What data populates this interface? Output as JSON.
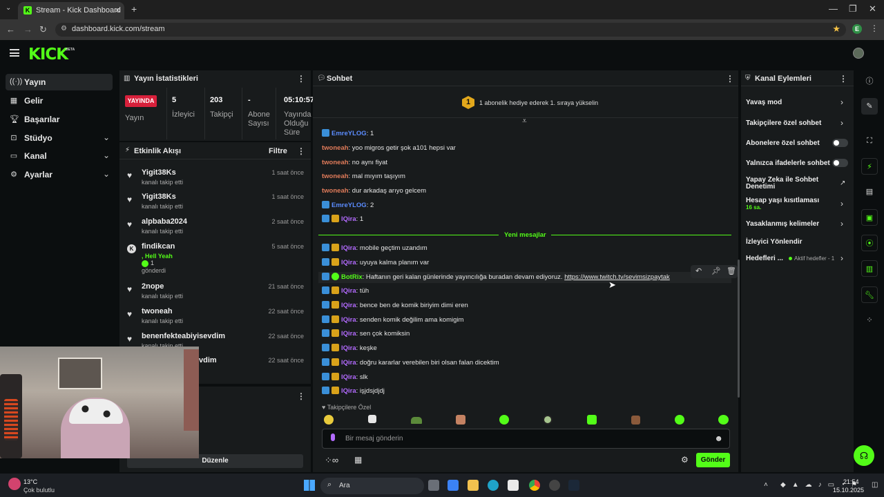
{
  "browser": {
    "tab_title": "Stream - Kick Dashboard",
    "url": "dashboard.kick.com/stream",
    "profile_initial": "E"
  },
  "app": {
    "logo": "KICK",
    "beta": "BETA"
  },
  "nav": {
    "items": [
      {
        "label": "Yayın",
        "icon": "broadcast-icon"
      },
      {
        "label": "Gelir",
        "icon": "money-icon"
      },
      {
        "label": "Başarılar",
        "icon": "trophy-icon"
      },
      {
        "label": "Stüdyo",
        "icon": "studio-icon"
      },
      {
        "label": "Kanal",
        "icon": "channel-icon"
      },
      {
        "label": "Ayarlar",
        "icon": "gear-icon"
      }
    ]
  },
  "stats": {
    "title": "Yayın İstatistikleri",
    "live": "YAYINDA",
    "live_label": "Yayın",
    "viewers": "5",
    "viewers_label": "İzleyici",
    "followers": "203",
    "followers_label": "Takipçi",
    "subs": "-",
    "subs_label_1": "Abone",
    "subs_label_2": "Sayısı",
    "duration": "05:10:57",
    "duration_label_1": "Yayında",
    "duration_label_2": "Olduğu",
    "duration_label_3": "Süre"
  },
  "activity": {
    "title": "Etkinlik Akışı",
    "filter": "Filtre",
    "items": [
      {
        "name": "Yigit38Ks",
        "sub": "kanalı takip etti",
        "time": "1 saat önce"
      },
      {
        "name": "Yigit38Ks",
        "sub": "kanalı takip etti",
        "time": "1 saat önce"
      },
      {
        "name": "alpbaba2024",
        "sub": "kanalı takip etti",
        "time": "2 saat önce"
      },
      {
        "name": "findikcan",
        "extra": ", Hell Yeah",
        "count": "1",
        "sub": "gönderdi",
        "time": "5 saat önce"
      },
      {
        "name": "2nope",
        "sub": "kanalı takip etti",
        "time": "21 saat önce"
      },
      {
        "name": "twoneah",
        "sub": "kanalı takip etti",
        "time": "22 saat önce"
      },
      {
        "name": "benenfekteabiyisevdim",
        "sub": "kanalı takip etti",
        "time": "22 saat önce"
      },
      {
        "name": "vdim",
        "sub": "",
        "time": "22 saat önce"
      }
    ],
    "edit": "Düzenle"
  },
  "chat": {
    "title": "Sohbet",
    "rank": "1",
    "gift_promo": "1 abonelik hediye ederek 1. sıraya yükselin",
    "new_messages": "Yeni mesajlar",
    "messages": [
      {
        "user": "EmreYLOG",
        "text": ": 1",
        "color": "#5b8cff",
        "badges": [
          "mod"
        ]
      },
      {
        "user": "twoneah",
        "text": ": yoo migros getir şok a101 hepsi var",
        "color": "#e07b5a",
        "badges": []
      },
      {
        "user": "twoneah",
        "text": ": no aynı fiyat",
        "color": "#e07b5a",
        "badges": []
      },
      {
        "user": "twoneah",
        "text": ": mal mıyım taşıyım",
        "color": "#e07b5a",
        "badges": []
      },
      {
        "user": "twoneah",
        "text": ": dur arkadaş arıyo gelcem",
        "color": "#e07b5a",
        "badges": []
      },
      {
        "user": "EmreYLOG",
        "text": ": 2",
        "color": "#5b8cff",
        "badges": [
          "mod"
        ]
      },
      {
        "user": "lQira",
        "text": ": 1",
        "color": "#b36bff",
        "badges": [
          "mod",
          "crown"
        ]
      },
      {
        "user": "lQira",
        "text": ": mobile geçtim uzandım",
        "color": "#b36bff",
        "badges": [
          "mod",
          "crown"
        ]
      },
      {
        "user": "lQira",
        "text": ": uyuya kalma planım var",
        "color": "#b36bff",
        "badges": [
          "mod",
          "crown"
        ]
      },
      {
        "user": "BotRix",
        "text": ": Haftanın geri kalan günlerinde yayıncılığa buradan devam ediyoruz. ",
        "link": "https://www.twitch.tv/sevimsizpaytak",
        "color": "#53fc18",
        "badges": [
          "mod",
          "bot"
        ]
      },
      {
        "user": "lQira",
        "text": ": tüh",
        "color": "#b36bff",
        "badges": [
          "mod",
          "crown"
        ]
      },
      {
        "user": "lQira",
        "text": ": bence ben de komik biriyim dimi eren",
        "color": "#b36bff",
        "badges": [
          "mod",
          "crown"
        ]
      },
      {
        "user": "lQira",
        "text": ": senden komik değilim ama komigim",
        "color": "#b36bff",
        "badges": [
          "mod",
          "crown"
        ]
      },
      {
        "user": "lQira",
        "text": ": sen çok komiksin",
        "color": "#b36bff",
        "badges": [
          "mod",
          "crown"
        ]
      },
      {
        "user": "lQira",
        "text": ": keşke",
        "color": "#b36bff",
        "badges": [
          "mod",
          "crown"
        ]
      },
      {
        "user": "lQira",
        "text": ": doğru kararlar verebilen biri olsan falan dicektim",
        "color": "#b36bff",
        "badges": [
          "mod",
          "crown"
        ]
      },
      {
        "user": "lQira",
        "text": ": slk",
        "color": "#b36bff",
        "badges": [
          "mod",
          "crown"
        ]
      },
      {
        "user": "lQira",
        "text": ": işjdsjdjdj",
        "color": "#b36bff",
        "badges": [
          "mod",
          "crown"
        ]
      }
    ],
    "followers_only": "Takipçilere Özel",
    "input_placeholder": "Bir mesaj gönderin",
    "send": "Gönder"
  },
  "channel_actions": {
    "title": "Kanal Eylemleri",
    "slow_mode": "Yavaş mod",
    "followers_chat": "Takipçilere özel sohbet",
    "subs_chat": "Abonelere özel sohbet",
    "emote_chat": "Yalnızca ifadelerle sohbet",
    "ai_moderation_1": "Yapay Zeka ile Sohbet",
    "ai_moderation_2": "Denetimi",
    "age_restriction": "Hesap yaşı kısıtlaması",
    "age_value": "16 sa.",
    "banned_words": "Yasaklanmış kelimeler",
    "raid": "İzleyici Yönlendir",
    "goals": "Hedefleri ...",
    "goals_status": "Aktif hedefler - 1"
  },
  "taskbar": {
    "temp": "13°C",
    "weather": "Çok bulutlu",
    "search": "Ara",
    "time": "21:54",
    "date": "15.10.2025"
  },
  "colors": {
    "accent": "#53fc18",
    "live": "#d8203b"
  }
}
